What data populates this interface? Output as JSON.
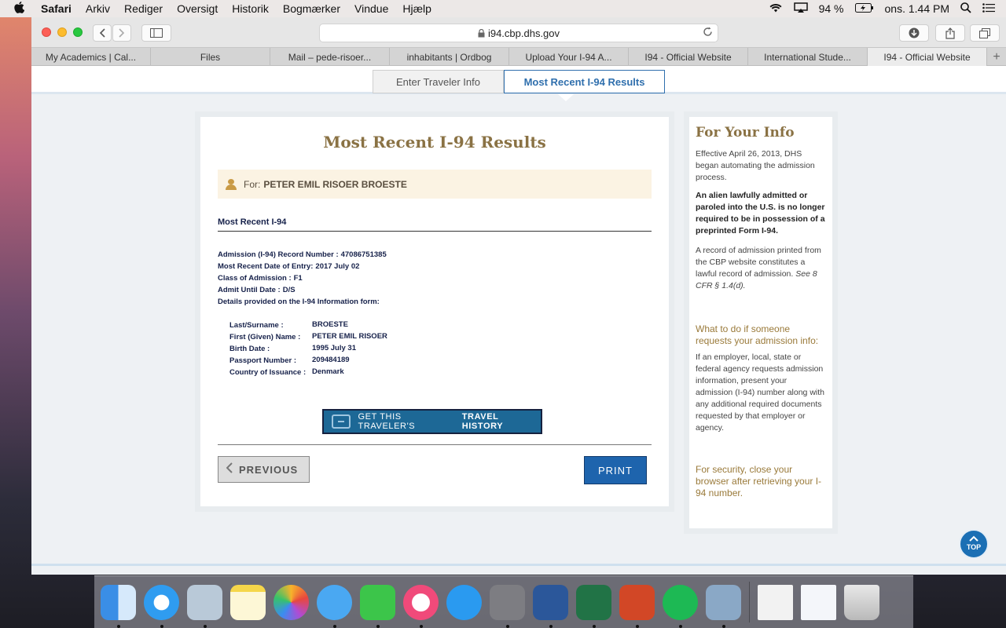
{
  "menubar": {
    "app": "Safari",
    "items": [
      "Arkiv",
      "Rediger",
      "Oversigt",
      "Historik",
      "Bogmærker",
      "Vindue",
      "Hjælp"
    ],
    "battery": "94 %",
    "clock": "ons. 1.44 PM"
  },
  "browser": {
    "url": "i94.cbp.dhs.gov",
    "tabs": [
      "My Academics | Cal...",
      "Files",
      "Mail – pede-risoer...",
      "inhabitants | Ordbog",
      "Upload Your I-94 A...",
      "I94 - Official Website",
      "International Stude...",
      "I94 - Official Website"
    ],
    "new_tab": "+"
  },
  "page_tabs": {
    "enter": "Enter Traveler Info",
    "recent": "Most Recent I-94 Results"
  },
  "main": {
    "title": "Most Recent I-94 Results",
    "for_label": "For:",
    "for_name": "PETER EMIL RISOER BROESTE",
    "section_title": "Most Recent I-94",
    "record": {
      "admission_label": "Admission (I-94) Record Number :",
      "admission_value": "47086751385",
      "entry_label": "Most Recent Date of Entry:",
      "entry_value": "2017 July 02",
      "class_label": "Class of Admission :",
      "class_value": "F1",
      "admit_label": "Admit Until Date :",
      "admit_value": "D/S",
      "details_label": "Details provided on the I-94 Information form:"
    },
    "details": [
      {
        "label": "Last/Surname :",
        "value": "BROESTE"
      },
      {
        "label": "First (Given) Name :",
        "value": "PETER EMIL RISOER"
      },
      {
        "label": "Birth Date :",
        "value": "1995 July 31"
      },
      {
        "label": "Passport Number :",
        "value": "209484189"
      },
      {
        "label": "Country of Issuance :",
        "value": "Denmark"
      }
    ],
    "travel_btn_pre": "GET THIS TRAVELER'S",
    "travel_btn_bold": "TRAVEL HISTORY",
    "prev_btn": "PREVIOUS",
    "print_btn": "PRINT"
  },
  "side": {
    "title": "For Your Info",
    "p1": "Effective April 26, 2013, DHS began automating the admission process.",
    "p2": "An alien lawfully admitted or paroled into the U.S. is no longer required to be in possession of a preprinted Form I-94.",
    "p3": "A record of admission printed from the CBP website constitutes a lawful record of admission.",
    "p3_cite": "See 8 CFR § 1.4(d).",
    "h1": "What to do if someone requests your admission info:",
    "p4": "If an employer, local, state or federal agency requests admission information, present your admission (I-94) number along with any additional required documents requested by that employer or agency.",
    "h2": "For security, close your browser after retrieving your I-94 number."
  },
  "top_btn": "TOP"
}
